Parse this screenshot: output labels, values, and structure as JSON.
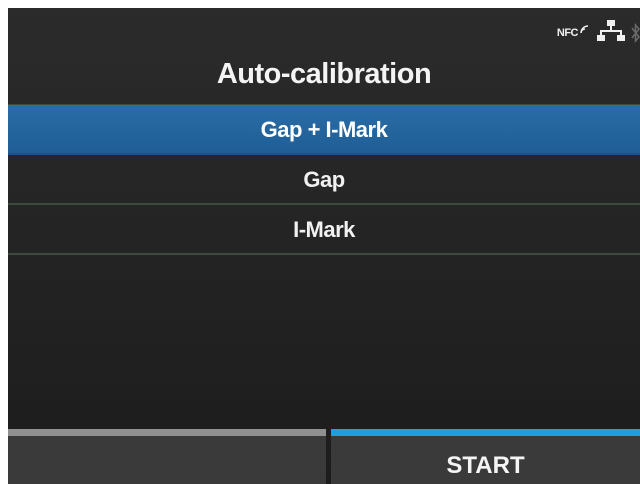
{
  "status": {
    "nfc_label": "NFC",
    "icons": [
      "nfc-icon",
      "network-icon",
      "bluetooth-icon"
    ]
  },
  "title": "Auto-calibration",
  "menu": {
    "items": [
      {
        "label": "Gap + I-Mark",
        "selected": true
      },
      {
        "label": "Gap",
        "selected": false
      },
      {
        "label": "I-Mark",
        "selected": false
      }
    ]
  },
  "softkeys": {
    "left_label": "",
    "right_label": "START"
  },
  "colors": {
    "selected_row": "#1f5e96",
    "right_softkey_accent": "#1e9fe0",
    "left_softkey_accent": "#909090",
    "divider": "#3d4a3f"
  }
}
